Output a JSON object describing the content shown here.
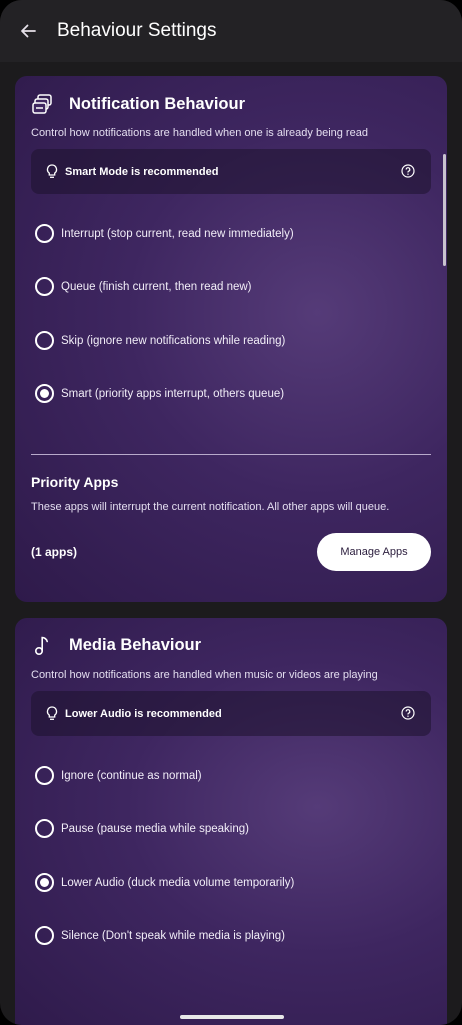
{
  "appbar": {
    "title": "Behaviour Settings"
  },
  "notification": {
    "title": "Notification Behaviour",
    "description": "Control how notifications are handled when one is already being read",
    "tip": "Smart Mode is recommended",
    "options": [
      {
        "label": "Interrupt (stop current, read new immediately)",
        "selected": false
      },
      {
        "label": "Queue (finish current, then read new)",
        "selected": false
      },
      {
        "label": "Skip (ignore new notifications while reading)",
        "selected": false
      },
      {
        "label": "Smart (priority apps interrupt, others queue)",
        "selected": true
      }
    ],
    "priority": {
      "title": "Priority Apps",
      "description": "These apps will interrupt the current notification. All other apps will queue.",
      "count": "(1 apps)",
      "button": "Manage Apps"
    }
  },
  "media": {
    "title": "Media Behaviour",
    "description": "Control how notifications are handled when music or videos are playing",
    "tip": "Lower Audio is recommended",
    "options": [
      {
        "label": "Ignore (continue as normal)",
        "selected": false
      },
      {
        "label": "Pause (pause media while speaking)",
        "selected": false
      },
      {
        "label": "Lower Audio (duck media volume temporarily)",
        "selected": true
      },
      {
        "label": "Silence (Don't speak while media is playing)",
        "selected": false
      }
    ]
  },
  "colors": {
    "card_accent": "#3e2660",
    "background": "#1c1b1d",
    "appbar": "#232225"
  }
}
